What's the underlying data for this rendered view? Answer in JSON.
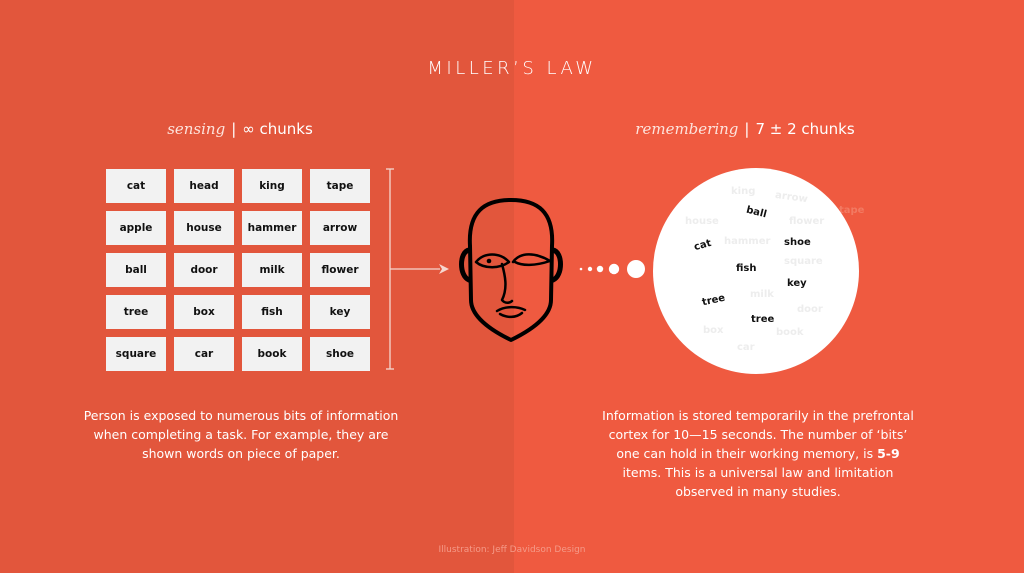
{
  "title": "MILLER’S LAW",
  "left": {
    "subhead_italic": "sensing",
    "subhead_separator": "|",
    "subhead_rest": "∞ chunks",
    "words": [
      [
        "cat",
        "head",
        "king",
        "tape"
      ],
      [
        "apple",
        "house",
        "hammer",
        "arrow"
      ],
      [
        "ball",
        "door",
        "milk",
        "flower"
      ],
      [
        "tree",
        "box",
        "fish",
        "key"
      ],
      [
        "square",
        "car",
        "book",
        "shoe"
      ]
    ],
    "description": "Person is exposed to numerous bits of information when completing a task. For example, they are shown words on piece of paper."
  },
  "center": {
    "icon": "face-icon",
    "arrow_icon": "arrow-right-icon",
    "dots_icon": "thought-dots-icon"
  },
  "right": {
    "subhead_italic": "remembering",
    "subhead_separator": "|",
    "subhead_rest": "7 ± 2 chunks",
    "remembered_words": [
      "ball",
      "cat",
      "shoe",
      "fish",
      "key",
      "tree",
      "tree"
    ],
    "faded_words": [
      "king",
      "arrow",
      "house",
      "flower",
      "hammer",
      "square",
      "milk",
      "door",
      "box",
      "book",
      "car",
      "tape"
    ],
    "description_parts": {
      "before_bold": "Information is stored temporarily in the prefrontal cortex for 10—15 seconds. The number of ‘bits’ one can hold in their working memory, is ",
      "bold": "5-9",
      "after_bold": " items. This is a universal law and limitation observed in many studies."
    }
  },
  "credit": "Illustration: Jeff Davidson Design",
  "colors": {
    "left_bg": "#E2563C",
    "right_bg": "#EF5A40",
    "card_bg": "#F2F2F2",
    "text": "#FFFFFF"
  }
}
